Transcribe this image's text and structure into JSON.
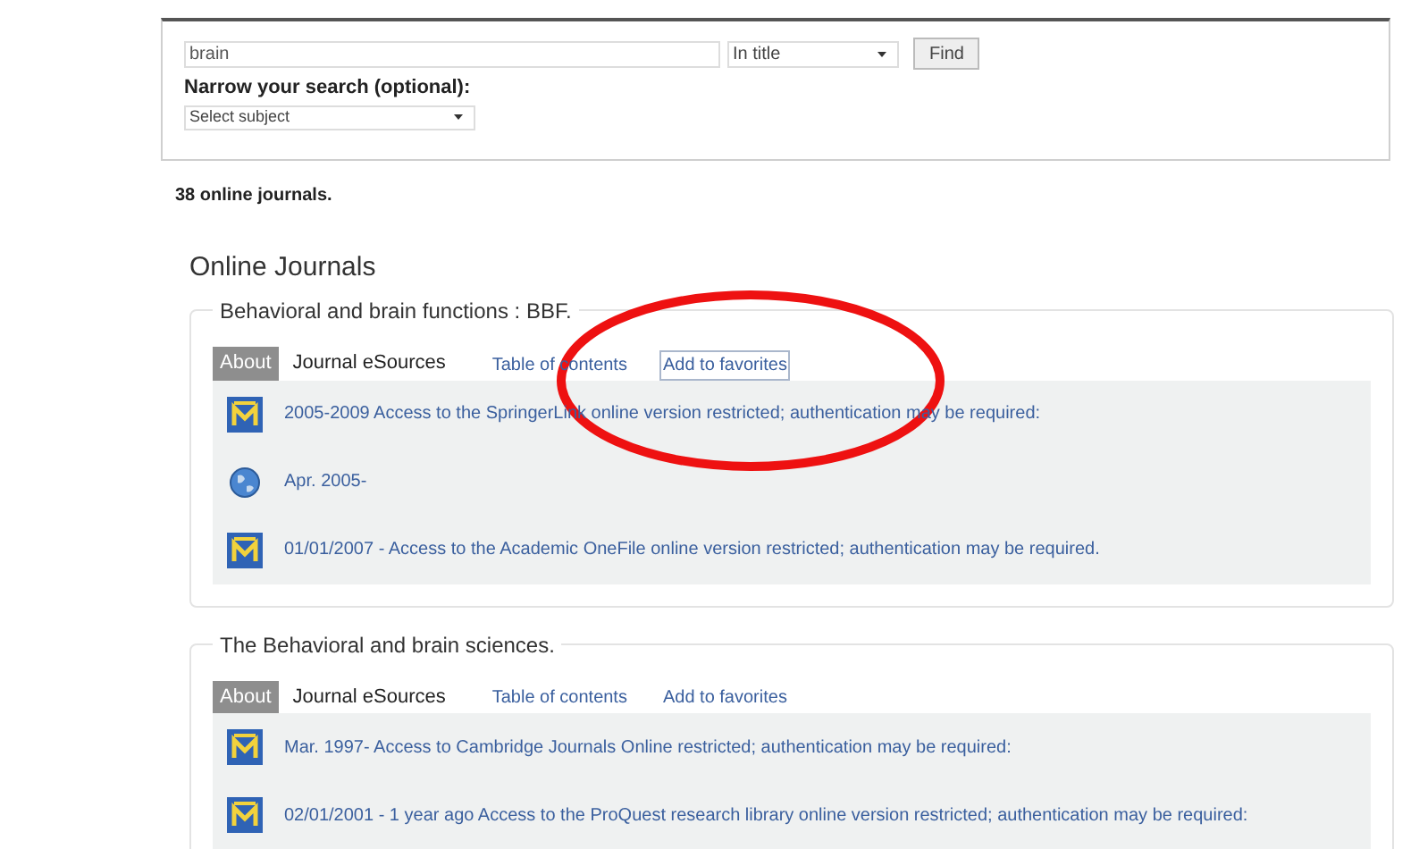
{
  "search": {
    "query": "brain",
    "scope": "In title",
    "button": "Find",
    "narrow_label": "Narrow your search (optional):",
    "subject": "Select subject"
  },
  "result_count": "38 online journals.",
  "heading": "Online Journals",
  "journals": [
    {
      "title": "Behavioral and brain functions : BBF.",
      "tabs": [
        {
          "label": "About",
          "selected": false
        },
        {
          "label": "Journal eSources",
          "selected": true
        }
      ],
      "links": [
        {
          "label": "Table of contents",
          "focused": false
        },
        {
          "label": "Add to favorites",
          "focused": true
        }
      ],
      "sources": [
        {
          "kind": "library",
          "text": "2005-2009 Access to the SpringerLink online version restricted; authentication may be required:"
        },
        {
          "kind": "web",
          "text": "Apr. 2005-"
        },
        {
          "kind": "library",
          "text": "01/01/2007 - Access to the Academic OneFile online version restricted; authentication may be required."
        }
      ]
    },
    {
      "title": "The Behavioral and brain sciences.",
      "tabs": [
        {
          "label": "About",
          "selected": false
        },
        {
          "label": "Journal eSources",
          "selected": true
        }
      ],
      "links": [
        {
          "label": "Table of contents",
          "focused": false
        },
        {
          "label": "Add to favorites",
          "focused": false
        }
      ],
      "sources": [
        {
          "kind": "library",
          "text": "Mar. 1997- Access to Cambridge Journals Online restricted; authentication may be required:"
        },
        {
          "kind": "library",
          "text": "02/01/2001 - 1 year ago Access to the ProQuest research library online version restricted; authentication may be required:"
        }
      ]
    }
  ],
  "annotation": {
    "kind": "ellipse"
  }
}
